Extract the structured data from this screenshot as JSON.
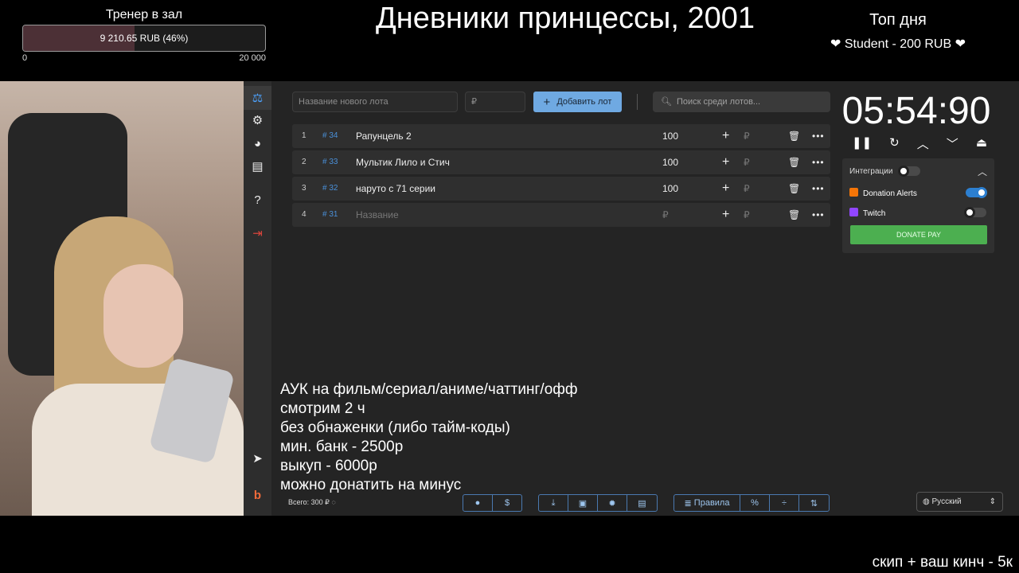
{
  "goal": {
    "title": "Тренер в зал",
    "progress_label": "9 210.65 RUB (46%)",
    "progress_fraction": 0.46,
    "min": "0",
    "max": "20 000"
  },
  "stream_title": "Дневники принцессы, 2001",
  "top_day": {
    "title": "Топ дня",
    "entry": "❤ Student - 200 RUB ❤"
  },
  "sidebar": {
    "items": [
      {
        "icon": "gavel-icon",
        "glyph": "⚖"
      },
      {
        "icon": "gear-icon",
        "glyph": "⚙"
      },
      {
        "icon": "wheel-icon",
        "glyph": "◕"
      },
      {
        "icon": "clipboard-icon",
        "glyph": "▤"
      },
      {
        "icon": "help-icon",
        "glyph": "?"
      },
      {
        "icon": "logout-icon",
        "glyph": "⇥"
      },
      {
        "icon": "telegram-icon",
        "glyph": "➤"
      },
      {
        "icon": "boosty-icon",
        "glyph": "b"
      }
    ]
  },
  "lot_form": {
    "name_placeholder": "Название нового лота",
    "amount_placeholder": "₽",
    "add_button": "Добавить лот",
    "search_placeholder": "Поиск среди лотов..."
  },
  "lots": [
    {
      "num": "1",
      "id": "# 34",
      "name": "Рапунцель 2",
      "amount": "100",
      "rub": "₽"
    },
    {
      "num": "2",
      "id": "# 33",
      "name": "Мультик Лило и Стич",
      "amount": "100",
      "rub": "₽"
    },
    {
      "num": "3",
      "id": "# 32",
      "name": "наруто с 71 серии",
      "amount": "100",
      "rub": "₽"
    },
    {
      "num": "4",
      "id": "# 31",
      "name": "Название",
      "amount": "₽",
      "rub": "₽"
    }
  ],
  "timer": {
    "value": "05:54:90",
    "controls": [
      "pause-icon",
      "restart-icon",
      "chevron-up-icon",
      "chevron-down-icon",
      "eject-icon"
    ]
  },
  "integrations": {
    "title": "Интеграции",
    "items": [
      {
        "name": "Donation Alerts",
        "enabled": true,
        "color": "#f57507"
      },
      {
        "name": "Twitch",
        "enabled": false,
        "color": "#9146ff"
      }
    ],
    "donate_pay": "DONATE PAY"
  },
  "conditions": [
    "АУК на фильм/сериал/аниме/чаттинг/офф",
    "смотрим 2 ч",
    "без обнаженки (либо тайм-коды)",
    "мин. банк - 2500р",
    "выкуп - 6000р",
    "можно донатить на минус"
  ],
  "total": "Всего: 300 ₽",
  "toolbar": {
    "rules": "Правила"
  },
  "language": "Русский",
  "bottom_note": "скип + ваш кинч - 5к",
  "colors": {
    "accent": "#6fa9e2",
    "background": "#242424",
    "donate_pay": "#4caf50"
  }
}
